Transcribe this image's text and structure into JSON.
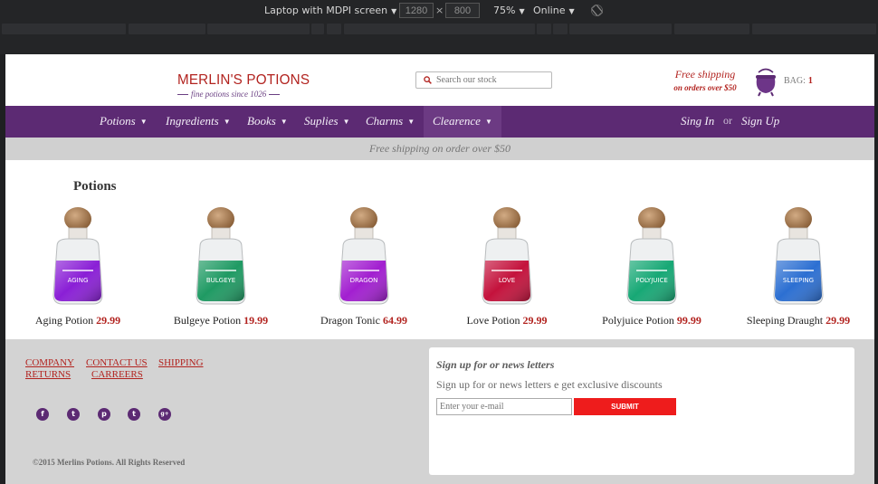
{
  "devtools": {
    "device": "Laptop with MDPI screen",
    "width": "1280",
    "times": "×",
    "height": "800",
    "zoom": "75%",
    "network": "Online",
    "rotate_icon": "rotate-icon"
  },
  "brand": {
    "name": "MERLIN'S POTIONS",
    "tagline": "fine potions since 1026",
    "colors": {
      "red": "#b2231f",
      "purple": "#5c2a73"
    }
  },
  "search": {
    "placeholder": "Search our stock",
    "icon": "search-icon"
  },
  "free_shipping": {
    "line1": "Free shipping",
    "line2": "on orders over $50"
  },
  "bag": {
    "label": "BAG:",
    "count": "1",
    "icon": "cauldron-icon"
  },
  "nav": {
    "items": [
      {
        "label": "Potions"
      },
      {
        "label": "Ingredients"
      },
      {
        "label": "Books"
      },
      {
        "label": "Suplies"
      },
      {
        "label": "Charms"
      },
      {
        "label": "Clearence"
      }
    ],
    "sign_in": "Sing In",
    "or": "or",
    "sign_up": "Sign Up"
  },
  "promo": "Free shipping on order over $50",
  "section_title": "Potions",
  "products": [
    {
      "name": "Aging Potion",
      "price": "29.99",
      "label": "AGING",
      "liquid": "#8a1fd6"
    },
    {
      "name": "Bulgeye Potion",
      "price": "19.99",
      "label": "BULGEYE",
      "liquid": "#1f9a63"
    },
    {
      "name": "Dragon Tonic",
      "price": "64.99",
      "label": "DRAGON",
      "liquid": "#a21fd0"
    },
    {
      "name": "Love Potion",
      "price": "29.99",
      "label": "LOVE",
      "liquid": "#c4123c"
    },
    {
      "name": "Polyjuice Potion",
      "price": "99.99",
      "label": "POLYJUICE",
      "liquid": "#17a875"
    },
    {
      "name": "Sleeping Draught",
      "price": "29.99",
      "label": "SLEEPING",
      "liquid": "#2c6fd2"
    }
  ],
  "footer": {
    "links": [
      "COMPANY",
      "CONTACT US",
      "SHIPPING",
      "RETURNS",
      "CARREERS"
    ],
    "social": [
      {
        "icon": "facebook-icon",
        "glyph": "f"
      },
      {
        "icon": "twitter-icon",
        "glyph": "t"
      },
      {
        "icon": "pinterest-icon",
        "glyph": "p"
      },
      {
        "icon": "tumblr-icon",
        "glyph": "t"
      },
      {
        "icon": "googleplus-icon",
        "glyph": "g+"
      }
    ],
    "copyright": "©2015 Merlins Potions. All Rights Reserved"
  },
  "newsletter": {
    "title": "Sign up for or news letters",
    "text": "Sign up for or news letters e get exclusive discounts",
    "placeholder": "Enter your e-mail",
    "submit": "SUBMIT"
  }
}
